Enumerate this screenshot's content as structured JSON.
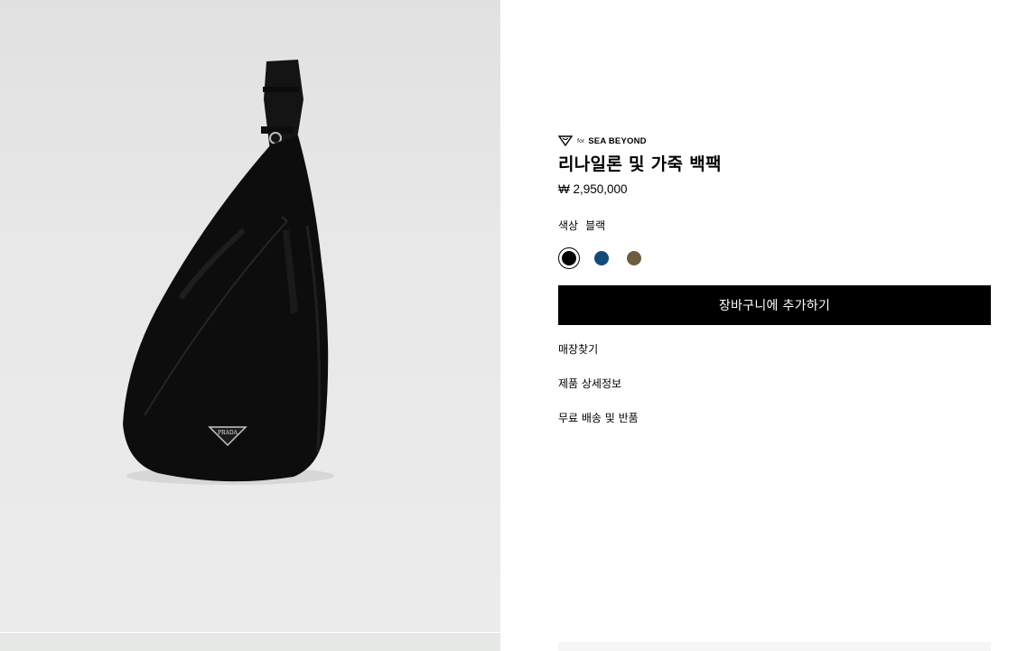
{
  "badge": {
    "prefix": "for",
    "brand": "SEA BEYOND"
  },
  "product": {
    "title": "리나일론 및 가죽 백팩",
    "price": "₩ 2,950,000",
    "image_alt": "리나일론 및 가죽 백팩",
    "logo_text": "PRADA"
  },
  "color": {
    "label": "색상",
    "selected": "블랙",
    "swatches": [
      {
        "name": "블랙",
        "hex": "#000000",
        "selected": true
      },
      {
        "name": "블루",
        "hex": "#144a7a",
        "selected": false
      },
      {
        "name": "올리브",
        "hex": "#6e5e40",
        "selected": false
      }
    ]
  },
  "actions": {
    "add_to_cart": "장바구니에 추가하기"
  },
  "links": [
    "매장찾기",
    "제품 상세정보",
    "무료 배송 및 반품"
  ]
}
